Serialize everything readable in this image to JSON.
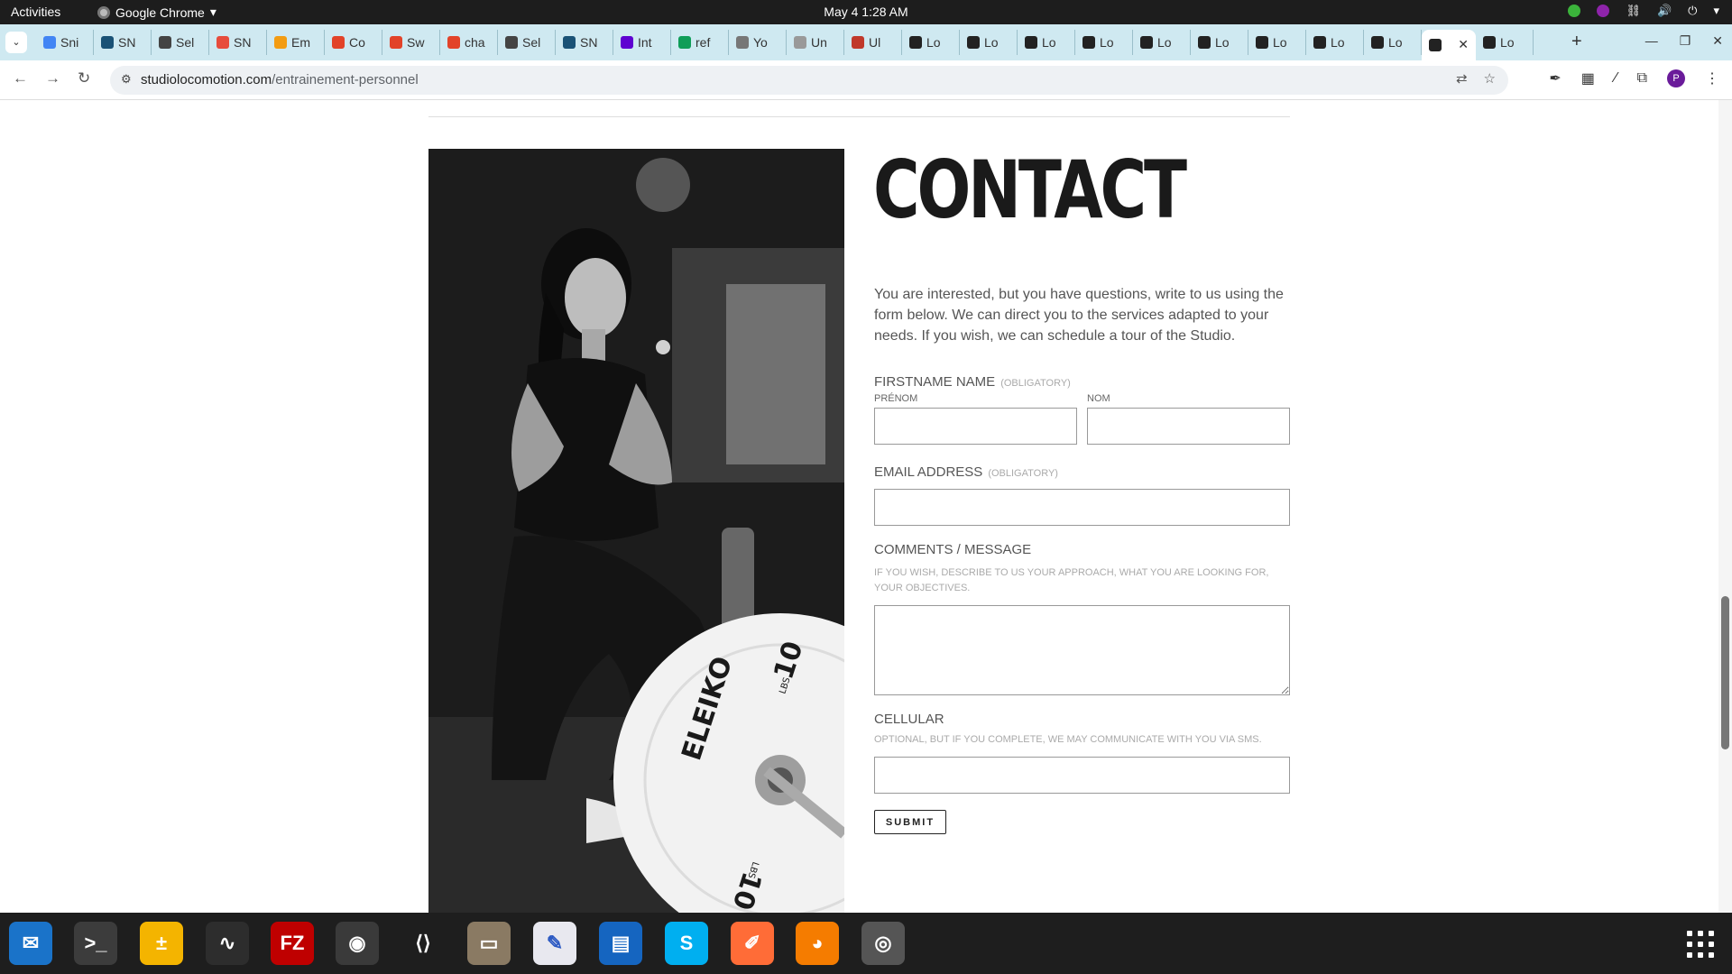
{
  "topbar": {
    "activities": "Activities",
    "app_name": "Google Chrome",
    "clock": "May 4  1:28 AM"
  },
  "tabs": [
    {
      "label": "Sni",
      "icon": "docs-icon",
      "color": "#4285f4"
    },
    {
      "label": "SN",
      "icon": "snp-icon",
      "color": "#1a5276"
    },
    {
      "label": "Sel",
      "icon": "globe-icon",
      "color": "#444444"
    },
    {
      "label": "SN",
      "icon": "smiley-icon",
      "color": "#e74c3c"
    },
    {
      "label": "Em",
      "icon": "emoji-icon",
      "color": "#f39c12"
    },
    {
      "label": "Co",
      "icon": "gitlab-icon",
      "color": "#e24329"
    },
    {
      "label": "Sw",
      "icon": "gitlab-icon",
      "color": "#e24329"
    },
    {
      "label": "cha",
      "icon": "gitlab-icon",
      "color": "#e24329"
    },
    {
      "label": "Sel",
      "icon": "globe-icon",
      "color": "#444444"
    },
    {
      "label": "SN",
      "icon": "snp-icon",
      "color": "#1a5276"
    },
    {
      "label": "Int",
      "icon": "yahoo-icon",
      "color": "#5f01d1"
    },
    {
      "label": "ref",
      "icon": "plus-icon",
      "color": "#0f9d58"
    },
    {
      "label": "Yo",
      "icon": "record-icon",
      "color": "#777777"
    },
    {
      "label": "Un",
      "icon": "page-icon",
      "color": "#999999"
    },
    {
      "label": "Ul",
      "icon": "chart-icon",
      "color": "#c0392b"
    },
    {
      "label": "Lo",
      "icon": "locomotion-icon",
      "color": "#222222"
    },
    {
      "label": "Lo",
      "icon": "locomotion-icon",
      "color": "#222222"
    },
    {
      "label": "Lo",
      "icon": "locomotion-icon",
      "color": "#222222"
    },
    {
      "label": "Lo",
      "icon": "locomotion-icon",
      "color": "#222222"
    },
    {
      "label": "Lo",
      "icon": "locomotion-icon",
      "color": "#222222"
    },
    {
      "label": "Lo",
      "icon": "locomotion-icon",
      "color": "#222222"
    },
    {
      "label": "Lo",
      "icon": "locomotion-icon",
      "color": "#222222"
    },
    {
      "label": "Lo",
      "icon": "locomotion-icon",
      "color": "#222222"
    },
    {
      "label": "Lo",
      "icon": "locomotion-icon",
      "color": "#222222"
    }
  ],
  "active_tab": {
    "label": "",
    "icon": "locomotion-icon"
  },
  "last_tab": {
    "label": "Lo",
    "icon": "locomotion-icon"
  },
  "address": {
    "domain": "studiolocomotion.com",
    "path": "/entrainement-personnel"
  },
  "profile_initial": "P",
  "contact": {
    "title": "CONTACT",
    "intro": "You are interested, but you have questions, write to us using the form below. We can direct you to the services adapted to your needs. If you wish, we can schedule a tour of the Studio.",
    "name_label": "FIRSTNAME NAME",
    "obligatory": "(OBLIGATORY)",
    "firstname_sub": "PRÉNOM",
    "lastname_sub": "NOM",
    "email_label": "EMAIL ADDRESS",
    "comments_label": "COMMENTS / MESSAGE",
    "comments_hint": "IF YOU WISH, DESCRIBE TO US YOUR APPROACH, WHAT YOU ARE LOOKING FOR, YOUR OBJECTIVES.",
    "cellular_label": "CELLULAR",
    "cellular_hint": "OPTIONAL, BUT IF YOU COMPLETE, WE MAY COMMUNICATE WITH YOU VIA SMS.",
    "submit": "SUBMIT"
  },
  "photo": {
    "plate_brand": "ELEIKO",
    "plate_weight": "10",
    "plate_unit": "LBS"
  },
  "dock": [
    {
      "name": "thunderbird-icon",
      "glyph": "✉",
      "bg": "#1a73c9",
      "running": true
    },
    {
      "name": "terminal-icon",
      "glyph": ">_",
      "bg": "#3c3c3c",
      "running": true
    },
    {
      "name": "calculator-icon",
      "glyph": "±",
      "bg": "#f4b400",
      "running": false
    },
    {
      "name": "system-monitor-icon",
      "glyph": "∿",
      "bg": "#2d2d2d",
      "running": false
    },
    {
      "name": "filezilla-icon",
      "glyph": "FZ",
      "bg": "#bf0000",
      "running": true
    },
    {
      "name": "chrome-icon",
      "glyph": "◉",
      "bg": "#3a3a3a",
      "running": true
    },
    {
      "name": "vscode-icon",
      "glyph": "⟨⟩",
      "bg": "#1e1e1e",
      "running": true
    },
    {
      "name": "files-icon",
      "glyph": "▭",
      "bg": "#8a7a63",
      "running": true
    },
    {
      "name": "text-editor-icon",
      "glyph": "✎",
      "bg": "#e8e8ef",
      "running": true
    },
    {
      "name": "writer-icon",
      "glyph": "▤",
      "bg": "#1565c0",
      "running": false
    },
    {
      "name": "skype-icon",
      "glyph": "S",
      "bg": "#00aff0",
      "running": true
    },
    {
      "name": "postman-icon",
      "glyph": "✐",
      "bg": "#ff6c37",
      "running": true
    },
    {
      "name": "blender-icon",
      "glyph": "◕",
      "bg": "#f57c00",
      "running": false
    },
    {
      "name": "disk-icon",
      "glyph": "◎",
      "bg": "#555555",
      "running": true
    }
  ]
}
